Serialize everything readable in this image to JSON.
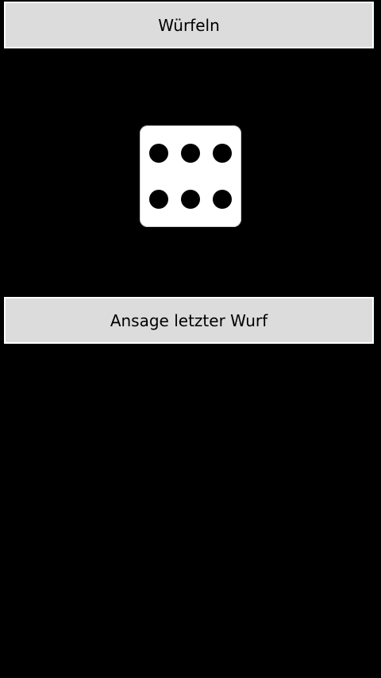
{
  "buttons": {
    "roll_label": "Würfeln",
    "announce_label": "Ansage letzter Wurf"
  },
  "die": {
    "value": 6,
    "face_color": "#ffffff",
    "pip_color": "#000000"
  },
  "colors": {
    "background": "#000000",
    "button_bg": "#dcdcdc",
    "button_border": "#ffffff"
  }
}
